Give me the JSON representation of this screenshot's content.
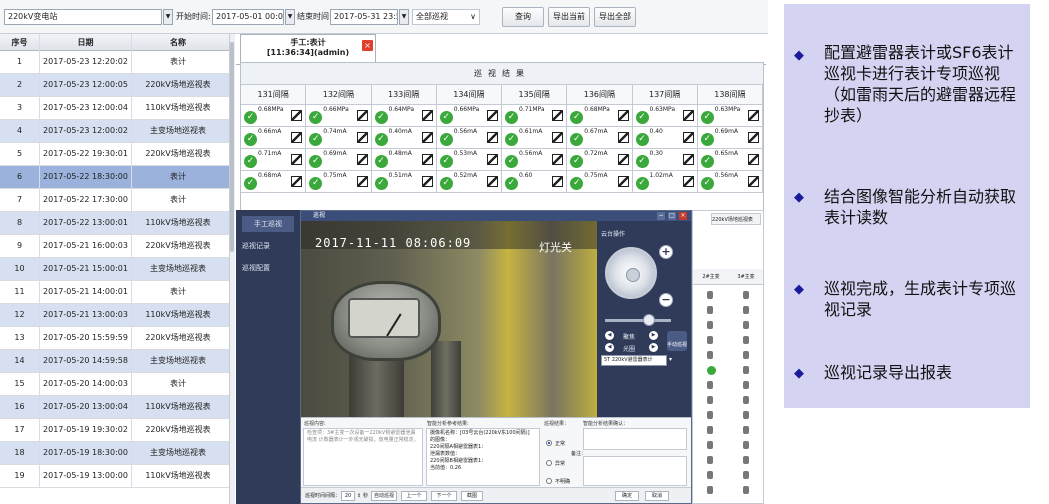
{
  "toolbar": {
    "station": "220kV变电站",
    "start_label": "开始时间:",
    "start_value": "2017-05-01 00:00:00",
    "end_label": "结束时间:",
    "end_value": "2017-05-31 23:59:59",
    "type_value": "全部巡视",
    "query_label": "查询",
    "export_current_label": "导出当前",
    "export_all_label": "导出全部"
  },
  "left_table": {
    "headers": [
      "序号",
      "日期",
      "名称"
    ],
    "rows": [
      {
        "no": "1",
        "date": "2017-05-23 12:20:02",
        "name": "表计"
      },
      {
        "no": "2",
        "date": "2017-05-23 12:00:05",
        "name": "220kV场地巡视表"
      },
      {
        "no": "3",
        "date": "2017-05-23 12:00:04",
        "name": "110kV场地巡视表"
      },
      {
        "no": "4",
        "date": "2017-05-23 12:00:02",
        "name": "主变场地巡视表"
      },
      {
        "no": "5",
        "date": "2017-05-22 19:30:01",
        "name": "220kV场地巡视表"
      },
      {
        "no": "6",
        "date": "2017-05-22 18:30:00",
        "name": "表计"
      },
      {
        "no": "7",
        "date": "2017-05-22 17:30:00",
        "name": "表计"
      },
      {
        "no": "8",
        "date": "2017-05-22 13:00:01",
        "name": "110kV场地巡视表"
      },
      {
        "no": "9",
        "date": "2017-05-21 16:00:03",
        "name": "220kV场地巡视表"
      },
      {
        "no": "10",
        "date": "2017-05-21 15:00:01",
        "name": "主变场地巡视表"
      },
      {
        "no": "11",
        "date": "2017-05-21 14:00:01",
        "name": "表计"
      },
      {
        "no": "12",
        "date": "2017-05-21 13:00:03",
        "name": "110kV场地巡视表"
      },
      {
        "no": "13",
        "date": "2017-05-20 15:59:59",
        "name": "220kV场地巡视表"
      },
      {
        "no": "14",
        "date": "2017-05-20 14:59:58",
        "name": "主变场地巡视表"
      },
      {
        "no": "15",
        "date": "2017-05-20 14:00:03",
        "name": "表计"
      },
      {
        "no": "16",
        "date": "2017-05-20 13:00:04",
        "name": "110kV场地巡视表"
      },
      {
        "no": "17",
        "date": "2017-05-19 19:30:02",
        "name": "220kV场地巡视表"
      },
      {
        "no": "18",
        "date": "2017-05-19 18:30:00",
        "name": "主变场地巡视表"
      },
      {
        "no": "19",
        "date": "2017-05-19 13:00:00",
        "name": "110kV场地巡视表"
      }
    ]
  },
  "tab": {
    "title": "手工:表计",
    "subtitle": "[11:36:34](admin)",
    "close": "×"
  },
  "grid": {
    "title": "巡视结果",
    "columns": [
      "131间隔",
      "132间隔",
      "133间隔",
      "134间隔",
      "135间隔",
      "136间隔",
      "137间隔",
      "138间隔"
    ],
    "rows": [
      [
        "0.68MPa",
        "0.66MPa",
        "0.64MPa",
        "0.66MPa",
        "0.71MPa",
        "0.68MPa",
        "0.63MPa",
        "0.63MPa"
      ],
      [
        "0.66mA",
        "0.74mA",
        "0.40mA",
        "0.56mA",
        "0.61mA",
        "0.67mA",
        "0.40",
        "0.69mA"
      ],
      [
        "0.71mA",
        "0.69mA",
        "0.48mA",
        "0.53mA",
        "0.56mA",
        "0.72mA",
        "0.30",
        "0.65mA"
      ],
      [
        "0.68mA",
        "0.75mA",
        "0.51mA",
        "0.52mA",
        "0.60",
        "0.75mA",
        "1.02mA",
        "0.56mA"
      ]
    ],
    "check": "✓"
  },
  "side_panel": {
    "items": [
      "手工巡视",
      "巡视记录",
      "巡视配置"
    ]
  },
  "popup": {
    "title": "巡视",
    "video_time": "2017-11-11 08:06:09",
    "video_tag": "灯光关",
    "ptz_label": "云台操作",
    "zoom_in": "+",
    "zoom_out": "−",
    "preset_label": "聚焦",
    "zoom_label": "光圈",
    "hand_label": "手动巡视",
    "camera_select": "5T  220kV避雷器表计",
    "content_label": "巡视内容:",
    "content_text": "检查项：3#主变一次设备一220kV侧避雷器泄漏电流 计数器表计一外观无破损，放电量正常稳定。",
    "analysis_label": "智能分析参考结果:",
    "analysis_text": "摄像机名称：[03号云台(220kV东100间隔)] 的图像：\n220间隔A相避雷器表1：\n泄漏表数值：\n220间隔B相避雷器表1：\n当前值：0.26",
    "result_label": "巡视结果：",
    "result_options": [
      "正常",
      "异常",
      "不明确"
    ],
    "confirm_label": "智能分析结果确认：",
    "remark_label": "备注：",
    "interval_label": "巡视时间间隔：",
    "interval_value": "20",
    "interval_unit": "秒",
    "auto_btn": "自动巡视",
    "prev_btn": "上一个",
    "next_btn": "下一个",
    "shot_btn": "截图",
    "ok_btn": "确定",
    "cancel_btn": "取消"
  },
  "right_strip": {
    "tab_label": "220kV场地巡视表",
    "h1": "2#主变",
    "h2": "3#主变"
  },
  "info": {
    "bullet_symbol": "◆",
    "items": [
      "配置避雷器表计或SF6表计巡视卡进行表计专项巡视（如雷雨天后的避雷器远程抄表）",
      "结合图像智能分析自动获取表计读数",
      "巡视完成，生成表计专项巡视记录",
      "巡视记录导出报表"
    ]
  }
}
